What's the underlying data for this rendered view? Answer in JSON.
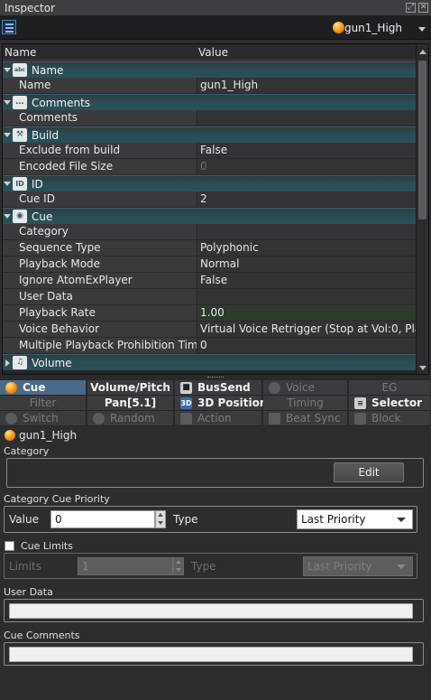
{
  "window": {
    "title": "Inspector"
  },
  "toolbar": {
    "object_name": "gun1_High"
  },
  "grid": {
    "headers": {
      "name": "Name",
      "value": "Value"
    },
    "categories": {
      "name": "Name",
      "comments": "Comments",
      "build": "Build",
      "id": "ID",
      "cue": "Cue",
      "volume": "Volume"
    },
    "props": {
      "name": {
        "label": "Name",
        "value": "gun1_High"
      },
      "comments": {
        "label": "Comments",
        "value": ""
      },
      "exclude": {
        "label": "Exclude from build",
        "value": "False"
      },
      "encoded": {
        "label": "Encoded File Size",
        "value": "0"
      },
      "cue_id": {
        "label": "Cue ID",
        "value": "2"
      },
      "category": {
        "label": "Category",
        "value": ""
      },
      "sequence_type": {
        "label": "Sequence Type",
        "value": "Polyphonic"
      },
      "playback_mode": {
        "label": "Playback Mode",
        "value": "Normal"
      },
      "ignore_player": {
        "label": "Ignore AtomExPlayer",
        "value": "False"
      },
      "user_data": {
        "label": "User Data",
        "value": ""
      },
      "playback_rate": {
        "label": "Playback Rate",
        "value": "1.00"
      },
      "voice_behavior": {
        "label": "Voice Behavior",
        "value": "Virtual Voice Retrigger (Stop at Vol:0, Playb..."
      },
      "multi_prohib": {
        "label": "Multiple Playback Prohibition Time",
        "value": "0"
      }
    }
  },
  "tabs": {
    "cue": "Cue",
    "volume_pitch": "Volume/Pitch",
    "bussend": "BusSend",
    "voice": "Voice",
    "eg": "EG",
    "filter": "Filter",
    "pan": "Pan[5.1]",
    "positioning": "3D Positioning",
    "timing": "Timing",
    "selector": "Selector",
    "switch": "Switch",
    "random": "Random",
    "action": "Action",
    "beat_sync": "Beat Sync",
    "block": "Block"
  },
  "panel": {
    "header_name": "gun1_High",
    "category_label": "Category",
    "edit_button": "Edit",
    "priority_label": "Category Cue Priority",
    "value_label": "Value",
    "value": "0",
    "type_label": "Type",
    "type_value": "Last Priority",
    "cue_limits_label": "Cue Limits",
    "limits_label": "Limits",
    "limits_value": "1",
    "limits_type_label": "Type",
    "limits_type_value": "Last Priority",
    "user_data_label": "User Data",
    "cue_comments_label": "Cue Comments"
  },
  "colors": {
    "accent_tab": "#4b6a88",
    "category_row": "#2b4d55",
    "orb": "#ff9c1a"
  }
}
